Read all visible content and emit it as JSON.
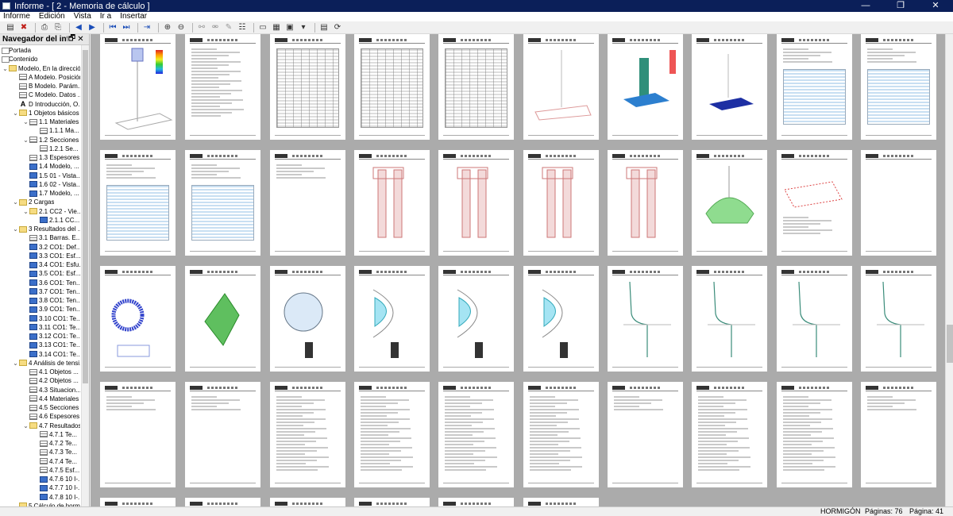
{
  "window": {
    "title": "Informe - [ 2 - Memoria de cálculo ]",
    "minimize": "—",
    "maximize": "❐",
    "close": "✕"
  },
  "menu": [
    "Informe",
    "Edición",
    "Vista",
    "Ir a",
    "Insertar"
  ],
  "toolbar": {
    "icons": [
      "new-report-icon",
      "delete-report-icon",
      "print-icon",
      "print-preview-icon",
      "previous-icon",
      "next-icon",
      "first-page-icon",
      "last-page-icon",
      "go-to-page-icon",
      "zoom-in-icon",
      "zoom-out-icon",
      "link-icon",
      "unlink-icon",
      "edit-icon",
      "settings-icon",
      "page-setup-icon",
      "table-icon",
      "image-icon",
      "export-icon",
      "refresh-icon"
    ]
  },
  "navigator": {
    "title": "Navegador del inf...",
    "pin": "🗗",
    "close": "✕",
    "items": [
      {
        "label": "Portada",
        "level": 0,
        "icon": "page",
        "exp": ""
      },
      {
        "label": "Contenido",
        "level": 0,
        "icon": "page",
        "exp": ""
      },
      {
        "label": "Modelo, En la dirección...",
        "level": 0,
        "icon": "folder",
        "exp": "v"
      },
      {
        "label": "A Modelo. Posición",
        "level": 1,
        "icon": "tbl",
        "exp": ""
      },
      {
        "label": "B Modelo. Parám...",
        "level": 1,
        "icon": "tbl",
        "exp": ""
      },
      {
        "label": "C Modelo. Datos ...",
        "level": 1,
        "icon": "tbl",
        "exp": ""
      },
      {
        "label": "D Introducción, O...",
        "level": 1,
        "icon": "txt",
        "exp": ""
      },
      {
        "label": "1 Objetos básicos",
        "level": 1,
        "icon": "folder",
        "exp": "v"
      },
      {
        "label": "1.1 Materiales",
        "level": 2,
        "icon": "tbl",
        "exp": "v"
      },
      {
        "label": "1.1.1 Ma...",
        "level": 3,
        "icon": "tbl",
        "exp": ""
      },
      {
        "label": "1.2 Secciones",
        "level": 2,
        "icon": "tbl",
        "exp": "v"
      },
      {
        "label": "1.2.1 Se...",
        "level": 3,
        "icon": "tbl",
        "exp": ""
      },
      {
        "label": "1.3 Espesores",
        "level": 2,
        "icon": "tbl",
        "exp": ""
      },
      {
        "label": "1.4 Modelo, ...",
        "level": 2,
        "icon": "img",
        "exp": ""
      },
      {
        "label": "1.5 01 - Vista...",
        "level": 2,
        "icon": "img",
        "exp": ""
      },
      {
        "label": "1.6 02 - Vista...",
        "level": 2,
        "icon": "img",
        "exp": ""
      },
      {
        "label": "1.7 Modelo, ...",
        "level": 2,
        "icon": "img",
        "exp": ""
      },
      {
        "label": "2 Cargas",
        "level": 1,
        "icon": "folder",
        "exp": "v"
      },
      {
        "label": "2.1 CC2 - Vie...",
        "level": 2,
        "icon": "folder",
        "exp": "v"
      },
      {
        "label": "2.1.1 CC...",
        "level": 3,
        "icon": "img",
        "exp": ""
      },
      {
        "label": "3 Resultados del ...",
        "level": 1,
        "icon": "folder",
        "exp": "v"
      },
      {
        "label": "3.1 Barras. E...",
        "level": 2,
        "icon": "tbl",
        "exp": ""
      },
      {
        "label": "3.2 CO1: Def...",
        "level": 2,
        "icon": "img",
        "exp": ""
      },
      {
        "label": "3.3 CO1: Esf...",
        "level": 2,
        "icon": "img",
        "exp": ""
      },
      {
        "label": "3.4 CO1: Esfu...",
        "level": 2,
        "icon": "img",
        "exp": ""
      },
      {
        "label": "3.5 CO1: Esf...",
        "level": 2,
        "icon": "img",
        "exp": ""
      },
      {
        "label": "3.6 CO1: Ten...",
        "level": 2,
        "icon": "img",
        "exp": ""
      },
      {
        "label": "3.7 CO1: Ten...",
        "level": 2,
        "icon": "img",
        "exp": ""
      },
      {
        "label": "3.8 CO1: Ten...",
        "level": 2,
        "icon": "img",
        "exp": ""
      },
      {
        "label": "3.9 CO1: Ten...",
        "level": 2,
        "icon": "img",
        "exp": ""
      },
      {
        "label": "3.10 CO1: Te...",
        "level": 2,
        "icon": "img",
        "exp": ""
      },
      {
        "label": "3.11 CO1: Te...",
        "level": 2,
        "icon": "img",
        "exp": ""
      },
      {
        "label": "3.12 CO1: Te...",
        "level": 2,
        "icon": "img",
        "exp": ""
      },
      {
        "label": "3.13 CO1: Te...",
        "level": 2,
        "icon": "img",
        "exp": ""
      },
      {
        "label": "3.14 CO1: Te...",
        "level": 2,
        "icon": "img",
        "exp": ""
      },
      {
        "label": "4 Análisis de tensi...",
        "level": 1,
        "icon": "folder",
        "exp": "v"
      },
      {
        "label": "4.1 Objetos ...",
        "level": 2,
        "icon": "tbl",
        "exp": ""
      },
      {
        "label": "4.2 Objetos ...",
        "level": 2,
        "icon": "tbl",
        "exp": ""
      },
      {
        "label": "4.3 Situacion...",
        "level": 2,
        "icon": "tbl",
        "exp": ""
      },
      {
        "label": "4.4 Materiales",
        "level": 2,
        "icon": "tbl",
        "exp": ""
      },
      {
        "label": "4.5 Secciones",
        "level": 2,
        "icon": "tbl",
        "exp": ""
      },
      {
        "label": "4.6 Espesores",
        "level": 2,
        "icon": "tbl",
        "exp": ""
      },
      {
        "label": "4.7 Resultados",
        "level": 2,
        "icon": "folder",
        "exp": "v"
      },
      {
        "label": "4.7.1 Te...",
        "level": 3,
        "icon": "tbl",
        "exp": ""
      },
      {
        "label": "4.7.2 Te...",
        "level": 3,
        "icon": "tbl",
        "exp": ""
      },
      {
        "label": "4.7.3 Te...",
        "level": 3,
        "icon": "tbl",
        "exp": ""
      },
      {
        "label": "4.7.4 Te...",
        "level": 3,
        "icon": "tbl",
        "exp": ""
      },
      {
        "label": "4.7.5 Esf...",
        "level": 3,
        "icon": "tbl",
        "exp": ""
      },
      {
        "label": "4.7.6 10 I-...",
        "level": 3,
        "icon": "img",
        "exp": ""
      },
      {
        "label": "4.7.7 10 I-...",
        "level": 3,
        "icon": "img",
        "exp": ""
      },
      {
        "label": "4.7.8 10 I-...",
        "level": 3,
        "icon": "img",
        "exp": ""
      },
      {
        "label": "5 Cálculo de horm...",
        "level": 1,
        "icon": "folder",
        "exp": "v"
      }
    ]
  },
  "pages": {
    "rows": [
      [
        "structure-3d",
        "text",
        "table-dense",
        "table-dense",
        "table-dense",
        "structure-flat",
        "contour-3d",
        "base-plate",
        "text-table",
        "text-table"
      ],
      [
        "text-table",
        "text-table",
        "text-short",
        "columns-red",
        "columns-red",
        "columns-red",
        "columns-red",
        "mesh-green",
        "mesh-red",
        "blank"
      ],
      [
        "section-ring",
        "section-green",
        "interaction-circle",
        "interaction-cyan",
        "interaction-cyan",
        "interaction-cyan",
        "curve",
        "curve",
        "curve",
        "curve"
      ],
      [
        "text-short",
        "text-short",
        "code",
        "code",
        "code",
        "code",
        "text-short",
        "code",
        "code",
        "text-short"
      ],
      [
        "blank",
        "blank",
        "blank",
        "blank",
        "blank",
        "blank"
      ]
    ]
  },
  "status": {
    "material": "HORMIGÓN",
    "pages_label": "Páginas: 76",
    "page_label": "Página: 41"
  }
}
